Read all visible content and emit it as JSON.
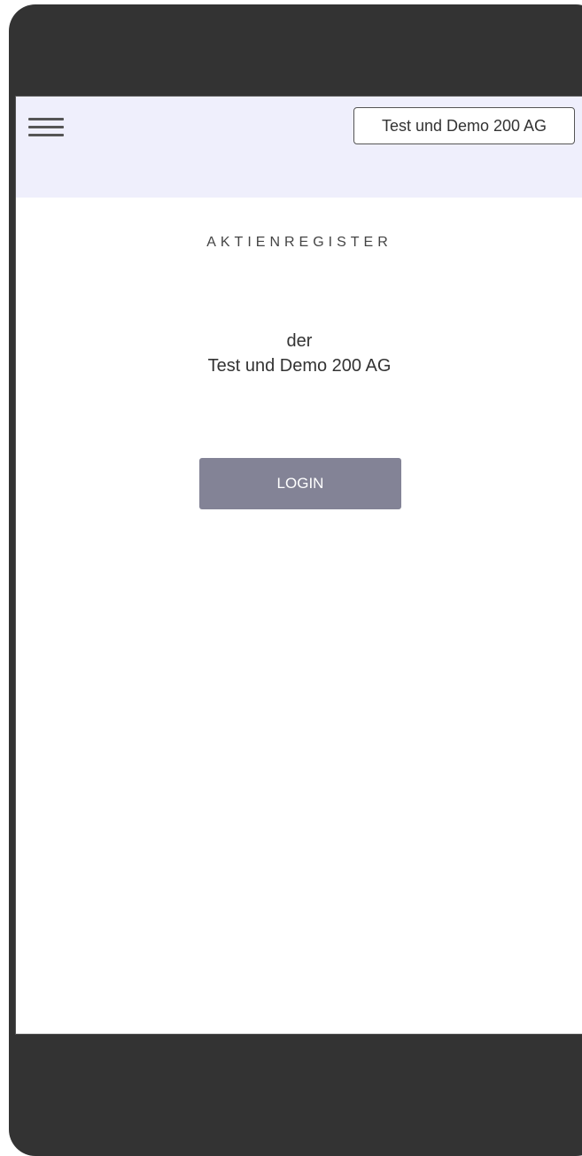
{
  "header": {
    "menu_icon": "hamburger-menu-icon",
    "company_name": "Test und Demo 200 AG"
  },
  "main": {
    "heading": "AKTIENREGISTER",
    "subtitle_line1": "der",
    "subtitle_line2": "Test und Demo 200 AG",
    "login_label": "LOGIN"
  },
  "colors": {
    "frame": "#333333",
    "header_background": "#efeffc",
    "button_background": "#838396",
    "button_text": "#ffffff"
  }
}
